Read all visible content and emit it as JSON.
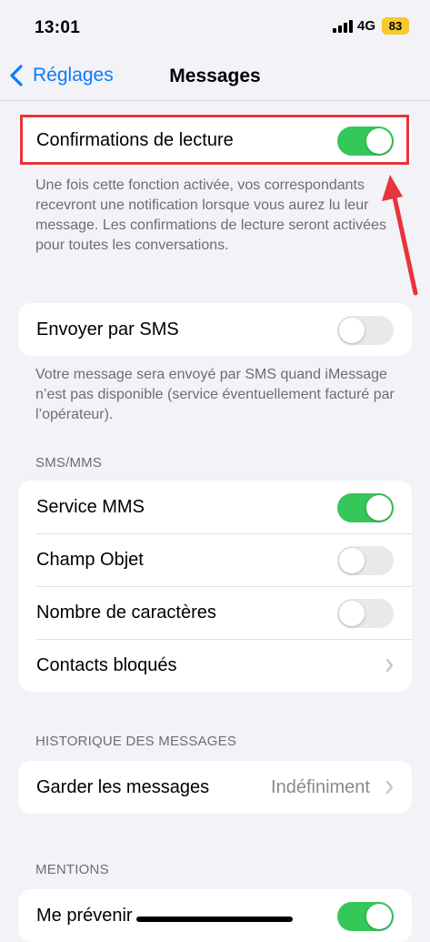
{
  "status": {
    "time": "13:01",
    "network": "4G",
    "battery": "83"
  },
  "nav": {
    "back_label": "Réglages",
    "title": "Messages"
  },
  "read_receipts": {
    "label": "Confirmations de lecture",
    "on": true,
    "description": "Une fois cette fonction activée, vos correspondants recevront une notification lorsque vous aurez lu leur message. Les confirmations de lecture seront activées pour toutes les conversations."
  },
  "send_sms": {
    "label": "Envoyer par SMS",
    "on": false,
    "description": "Votre message sera envoyé par SMS quand iMessage n’est pas disponible (service éventuellement facturé par l’opérateur)."
  },
  "sms_mms": {
    "header": "SMS/MMS",
    "rows": [
      {
        "label": "Service MMS",
        "on": true
      },
      {
        "label": "Champ Objet",
        "on": false
      },
      {
        "label": "Nombre de caractères",
        "on": false
      },
      {
        "label": "Contacts bloqués"
      }
    ]
  },
  "history": {
    "header": "HISTORIQUE DES MESSAGES",
    "label": "Garder les messages",
    "value": "Indéfiniment"
  },
  "mentions": {
    "header": "MENTIONS",
    "label": "Me prévenir",
    "on": true
  },
  "colors": {
    "accent": "#0a7bff",
    "toggle_on": "#34c759",
    "highlight": "#e8343b"
  }
}
